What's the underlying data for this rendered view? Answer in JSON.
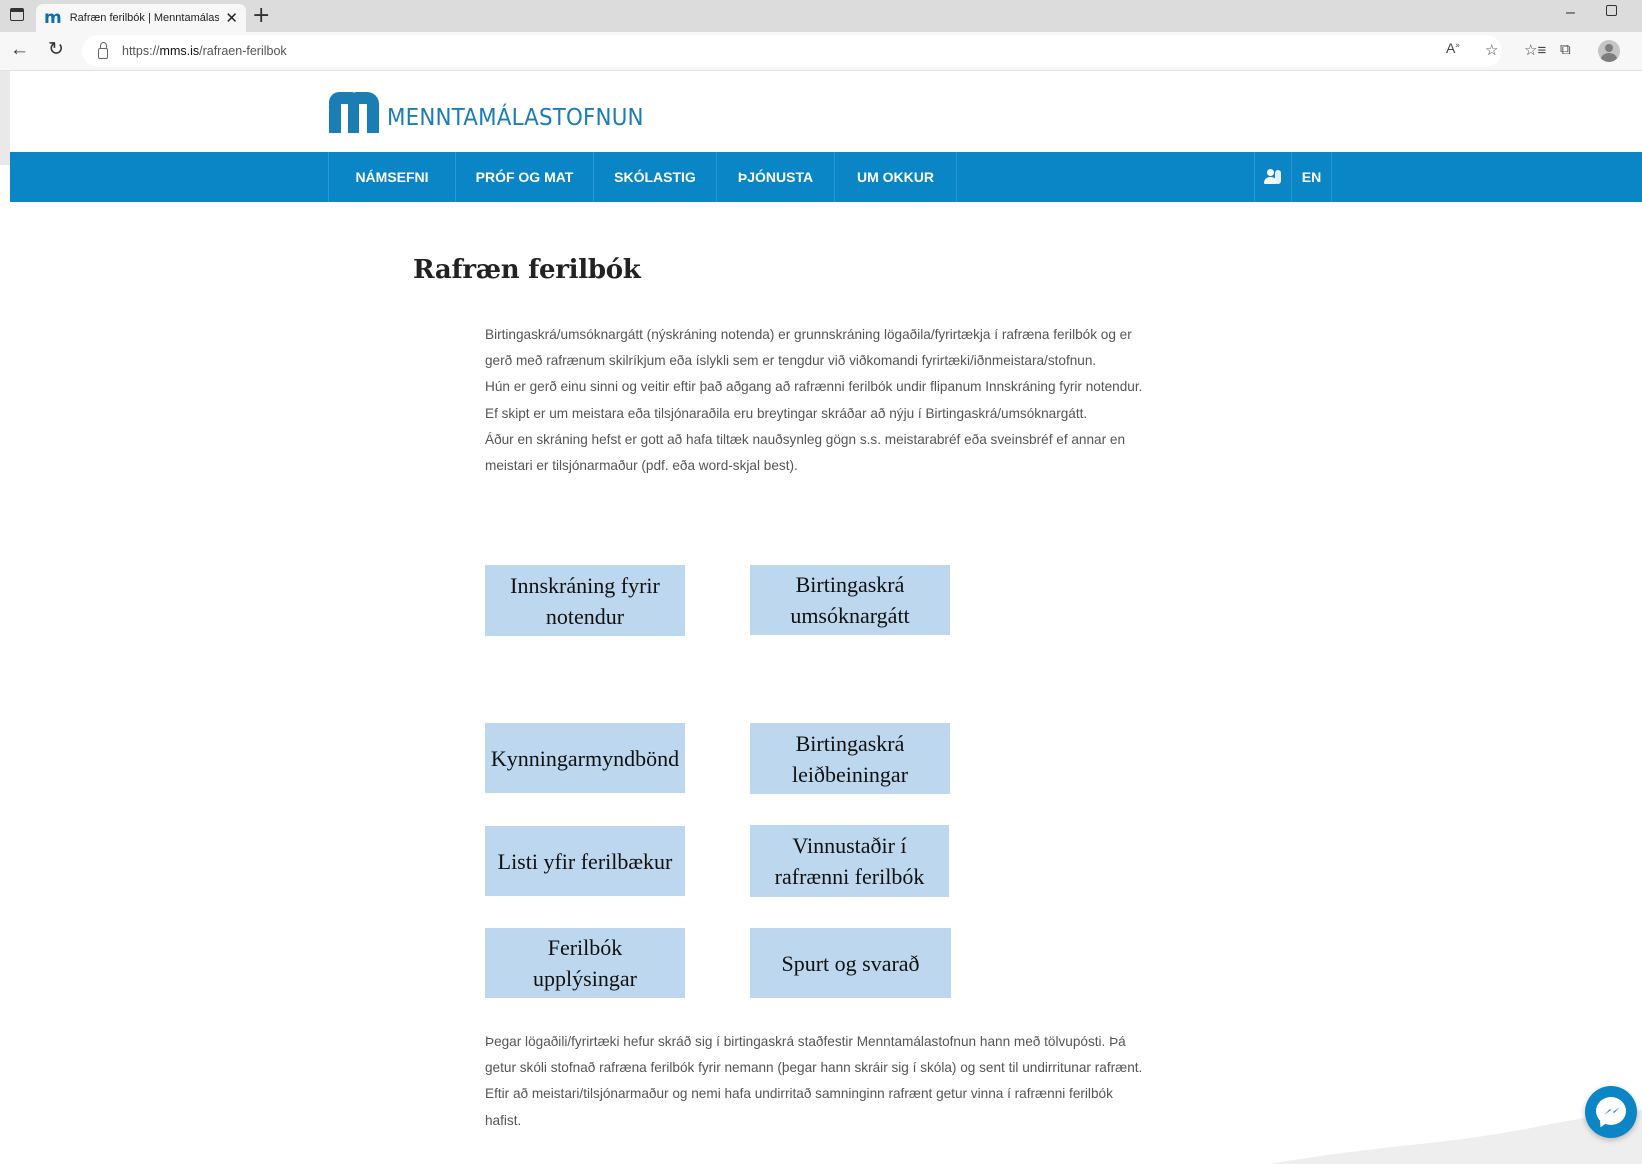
{
  "browser": {
    "tab_title": "Rafræn ferilbók | Menntamálasto",
    "tab_close": "✕",
    "new_tab": "+",
    "url_prefix": "https://",
    "url_domain": "mms.is",
    "url_path": "/rafraen-ferilbok",
    "icons": [
      "sidebar-icon",
      "back-icon",
      "reload-icon",
      "lock-icon",
      "read-aloud-icon",
      "add-favorite-icon",
      "favorites-icon",
      "collections-icon",
      "profile-icon",
      "minimize-icon",
      "restore-icon"
    ]
  },
  "site": {
    "logo_text": "MENNTAMÁLASTOFNUN",
    "brand_color": "#0a86c7",
    "nav": [
      "NÁMSEFNI",
      "PRÓF OG MAT",
      "SKÓLASTIG",
      "ÞJÓNUSTA",
      "UM OKKUR"
    ],
    "lang": "EN"
  },
  "main": {
    "title": "Rafræn ferilbók",
    "intro_lines": [
      "Birtingaskrá/umsóknargátt (nýskráning notenda) er grunnskráning lögaðila/fyrirtækja í rafræna ferilbók og er",
      "gerð með rafrænum skilríkjum eða íslykli sem er tengdur við viðkomandi fyrirtæki/iðnmeistara/stofnun.",
      "Hún er gerð einu sinni og veitir eftir það aðgang að rafrænni ferilbók undir flipanum Innskráning fyrir notendur.",
      "Ef skipt er um meistara eða tilsjónaraðila eru breytingar skráðar að nýju í Birtingaskrá/umsóknargátt.",
      "Áður en skráning hefst er gott að hafa tiltæk nauðsynleg gögn s.s. meistarabréf eða sveinsbréf ef annar en",
      "meistari er tilsjónarmaður (pdf. eða word-skjal best)."
    ],
    "buttons": [
      {
        "lines": [
          "Innskráning fyrir",
          "notendur"
        ]
      },
      {
        "lines": [
          "Birtingaskrá",
          "umsóknargátt"
        ]
      },
      {
        "lines": [
          "Kynningarmyndbönd"
        ]
      },
      {
        "lines": [
          "Birtingaskrá",
          "leiðbeiningar"
        ]
      },
      {
        "lines": [
          "Listi yfir ferilbækur"
        ]
      },
      {
        "lines": [
          "Vinnustaðir í",
          "rafrænni ferilbók"
        ]
      },
      {
        "lines": [
          "Ferilbók",
          "upplýsingar"
        ]
      },
      {
        "lines": [
          "Spurt og svarað"
        ]
      }
    ],
    "button_color": "#bdd7ee",
    "outro_lines": [
      "Þegar lögaðili/fyrirtæki hefur skráð sig í birtingaskrá staðfestir Menntamálastofnun hann með tölvupósti. Þá",
      "getur skóli stofnað rafræna ferilbók fyrir nemann (þegar hann skráir sig í skóla) og sent til undirritunar rafrænt.",
      "Eftir að meistari/tilsjónarmaður og nemi hafa undirritað samninginn rafrænt getur vinna í rafrænni ferilbók",
      "hafist."
    ]
  }
}
